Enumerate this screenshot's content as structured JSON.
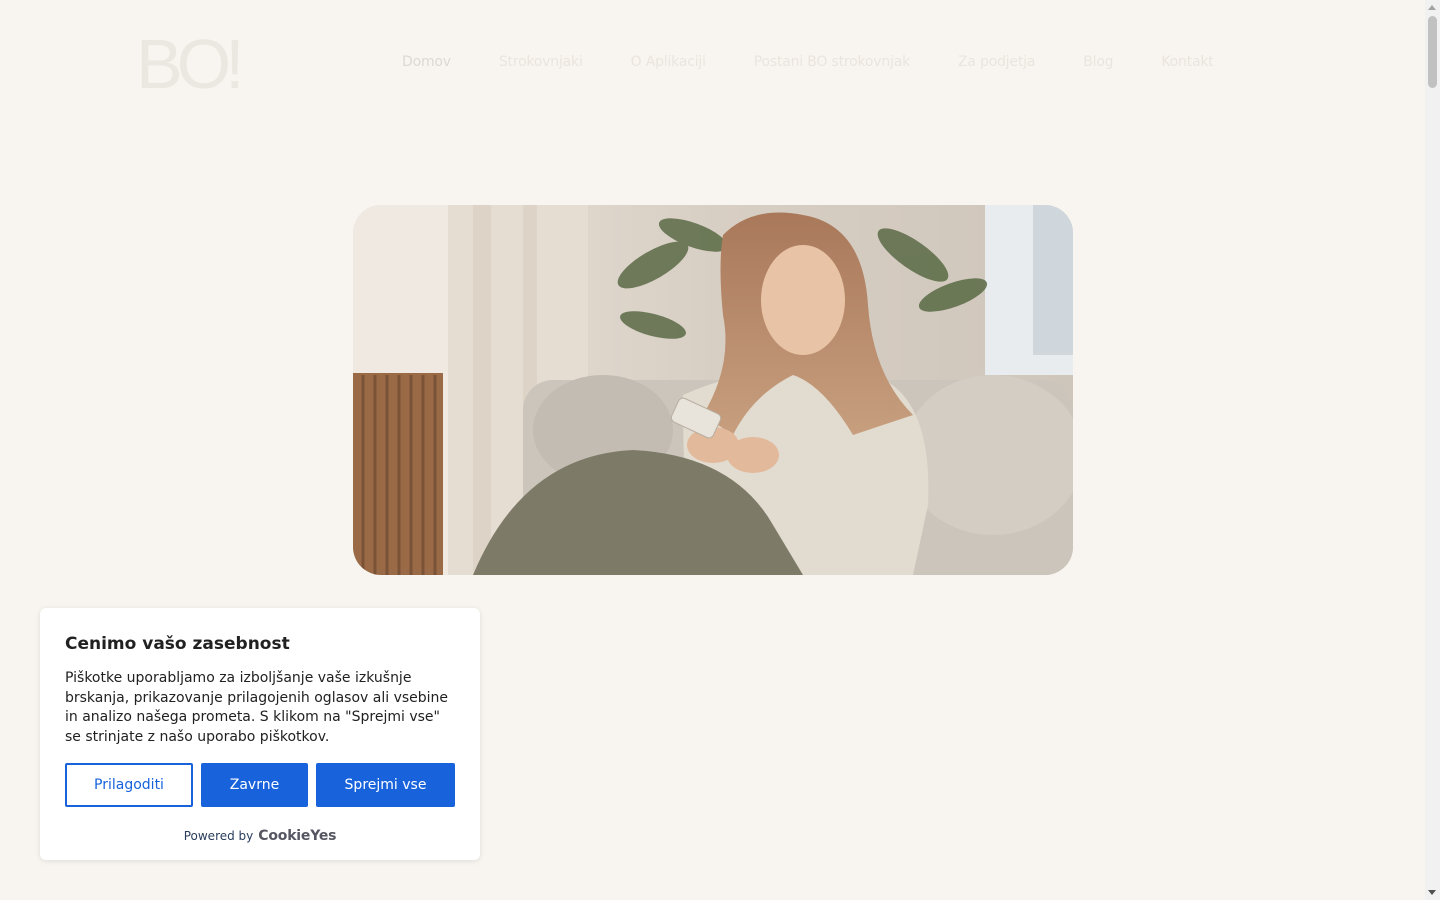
{
  "header": {
    "logo_text": "BO!",
    "nav": [
      {
        "label": "Domov"
      },
      {
        "label": "Strokovnjaki"
      },
      {
        "label": "O Aplikaciji"
      },
      {
        "label": "Postani BO strokovnjak"
      },
      {
        "label": "Za podjetja"
      },
      {
        "label": "Blog"
      },
      {
        "label": "Kontakt"
      }
    ]
  },
  "hero": {
    "image_icon": "woman-on-sofa-with-phone-photo"
  },
  "cookie_banner": {
    "title": "Cenimo vašo zasebnost",
    "text": "Piškotke uporabljamo za izboljšanje vaše izkušnje brskanja, prikazovanje prilagojenih oglasov ali vsebine in analizo našega prometa. S klikom na \"Sprejmi vse\" se strinjate z našo uporabo piškotkov.",
    "customize_label": "Prilagoditi",
    "reject_label": "Zavrne",
    "accept_label": "Sprejmi vse",
    "powered_by": "Powered by",
    "brand": "CookieYes",
    "accent_color": "#1863dc"
  },
  "colors": {
    "page_background": "#f8f5f0"
  }
}
